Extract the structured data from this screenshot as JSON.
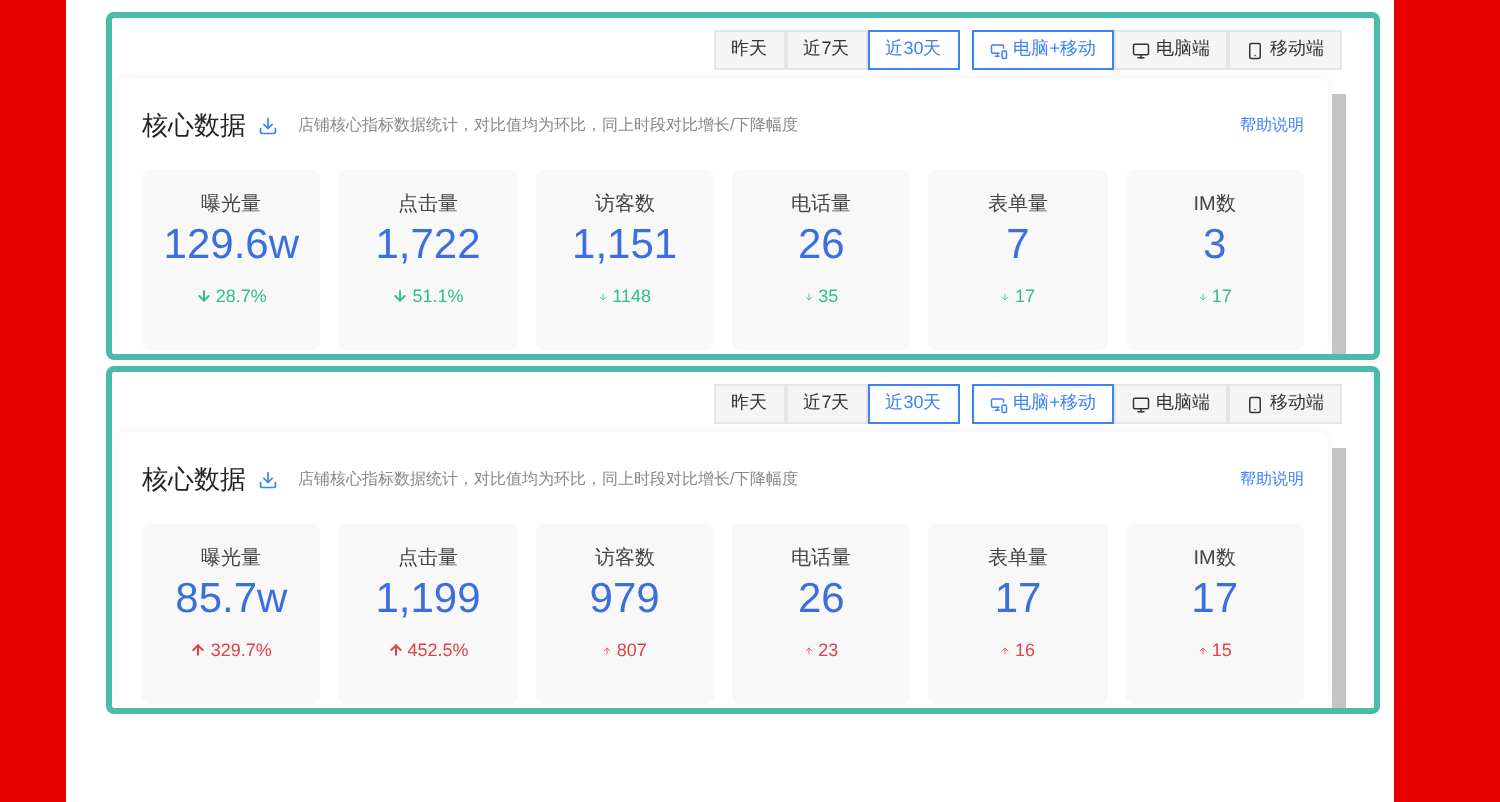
{
  "panels": [
    {
      "date_tabs": [
        {
          "label": "昨天",
          "selected": false
        },
        {
          "label": "近7天",
          "selected": false
        },
        {
          "label": "近30天",
          "selected": true
        }
      ],
      "device_tabs": [
        {
          "label": "电脑+移动",
          "kind": "both",
          "selected": true
        },
        {
          "label": "电脑端",
          "kind": "desktop",
          "selected": false
        },
        {
          "label": "移动端",
          "kind": "mobile",
          "selected": false
        }
      ],
      "title": "核心数据",
      "note": "店铺核心指标数据统计，对比值均为环比，同上时段对比增长/下降幅度",
      "help": "帮助说明",
      "metrics": [
        {
          "label": "曝光量",
          "value": "129.6w",
          "change": "28.7%",
          "increase": false,
          "arrow": true
        },
        {
          "label": "点击量",
          "value": "1,722",
          "change": "51.1%",
          "increase": false,
          "arrow": true
        },
        {
          "label": "访客数",
          "value": "1,151",
          "change": "1148",
          "increase": false,
          "arrow": false
        },
        {
          "label": "电话量",
          "value": "26",
          "change": "35",
          "increase": false,
          "arrow": false
        },
        {
          "label": "表单量",
          "value": "7",
          "change": "17",
          "increase": false,
          "arrow": false
        },
        {
          "label": "IM数",
          "value": "3",
          "change": "17",
          "increase": false,
          "arrow": false
        }
      ]
    },
    {
      "date_tabs": [
        {
          "label": "昨天",
          "selected": false
        },
        {
          "label": "近7天",
          "selected": false
        },
        {
          "label": "近30天",
          "selected": true
        }
      ],
      "device_tabs": [
        {
          "label": "电脑+移动",
          "kind": "both",
          "selected": true
        },
        {
          "label": "电脑端",
          "kind": "desktop",
          "selected": false
        },
        {
          "label": "移动端",
          "kind": "mobile",
          "selected": false
        }
      ],
      "title": "核心数据",
      "note": "店铺核心指标数据统计，对比值均为环比，同上时段对比增长/下降幅度",
      "help": "帮助说明",
      "metrics": [
        {
          "label": "曝光量",
          "value": "85.7w",
          "change": "329.7%",
          "increase": true,
          "arrow": true
        },
        {
          "label": "点击量",
          "value": "1,199",
          "change": "452.5%",
          "increase": true,
          "arrow": true
        },
        {
          "label": "访客数",
          "value": "979",
          "change": "807",
          "increase": true,
          "arrow": false
        },
        {
          "label": "电话量",
          "value": "26",
          "change": "23",
          "increase": true,
          "arrow": false
        },
        {
          "label": "表单量",
          "value": "17",
          "change": "16",
          "increase": true,
          "arrow": false
        },
        {
          "label": "IM数",
          "value": "17",
          "change": "15",
          "increase": true,
          "arrow": false
        }
      ]
    }
  ]
}
